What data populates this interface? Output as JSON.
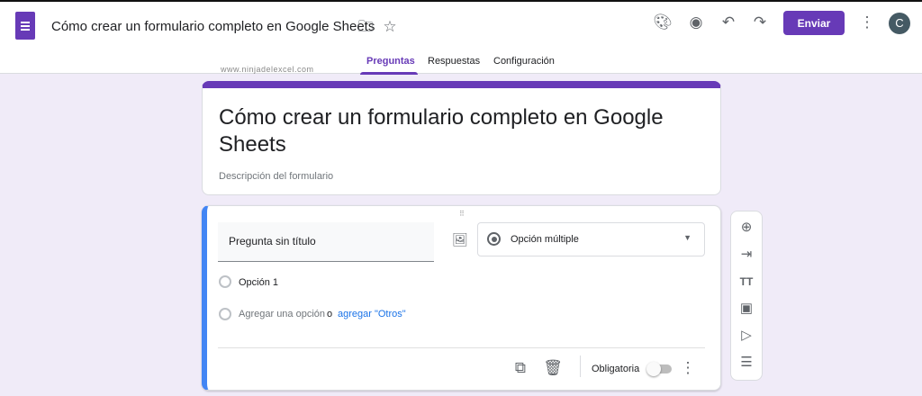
{
  "header": {
    "title": "Cómo crear un formulario completo en Google Sheets",
    "send_label": "Enviar",
    "avatar_initial": "C",
    "icons": [
      "forms-logo-icon",
      "folder-icon",
      "star-icon",
      "palette-icon",
      "eye-icon",
      "undo-icon",
      "redo-icon",
      "more-vert-icon"
    ]
  },
  "tabs": [
    {
      "label": "Preguntas",
      "active": true
    },
    {
      "label": "Respuestas"
    },
    {
      "label": "Configuración"
    }
  ],
  "watermark": "www.ninjadelexcel.com",
  "form": {
    "title": "Cómo crear un formulario completo en Google Sheets",
    "description_placeholder": "Descripción del formulario"
  },
  "question": {
    "title_placeholder": "Pregunta sin título",
    "type": "Opción múltiple",
    "options": [
      "Opción 1"
    ],
    "add_option": "Agregar una opción",
    "or": "o",
    "add_other": "agregar \"Otros\"",
    "required_label": "Obligatoria",
    "required": false
  },
  "side_toolbar": [
    "add-question-icon",
    "import-questions-icon",
    "add-title-icon",
    "add-image-icon",
    "add-video-icon",
    "add-section-icon"
  ],
  "colors": {
    "accent": "#673ab7",
    "active_border": "#4285f4",
    "background": "#f0ebf8"
  }
}
